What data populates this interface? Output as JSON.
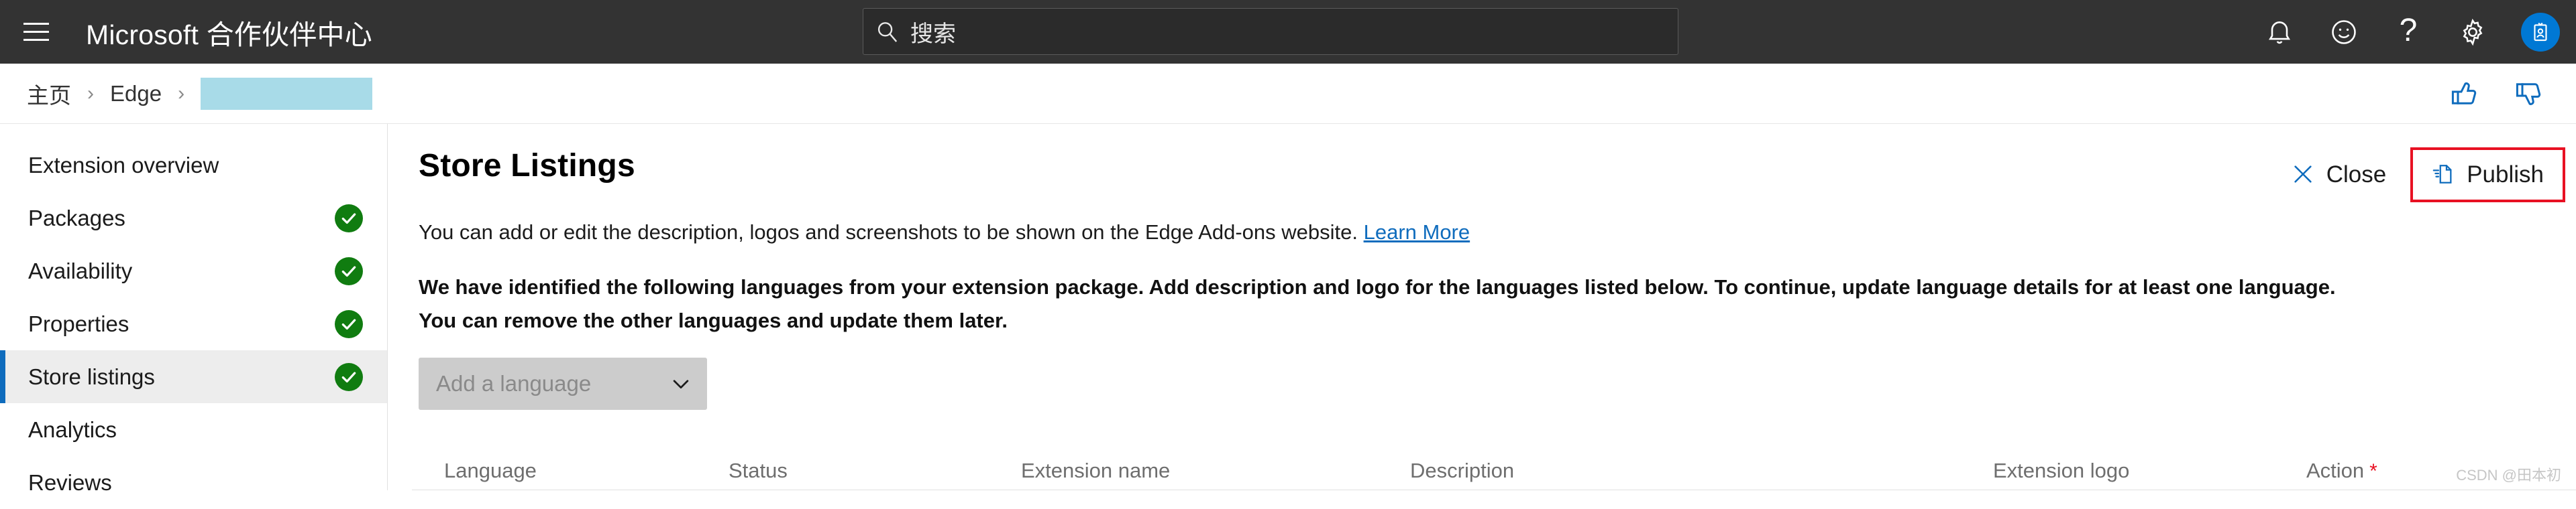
{
  "header": {
    "menu_icon": "hamburger-icon",
    "brand": "Microsoft 合作伙伴中心",
    "search": {
      "icon": "search-icon",
      "placeholder": "搜索",
      "value": ""
    },
    "icons": [
      {
        "name": "bell-icon",
        "label": "Notifications"
      },
      {
        "name": "smiley-icon",
        "label": "Feedback"
      },
      {
        "name": "question-icon",
        "label": "Help"
      },
      {
        "name": "gear-icon",
        "label": "Settings"
      }
    ],
    "avatar": {
      "name": "account-badge-icon",
      "color": "#0078d4"
    },
    "background": "#333333"
  },
  "breadcrumb": {
    "items": [
      "主页",
      "Edge"
    ],
    "separator": "›",
    "redacted_item": "",
    "feedback": [
      {
        "name": "thumbs-up-icon",
        "color": "#0f6cbd"
      },
      {
        "name": "thumbs-down-icon",
        "color": "#0f6cbd"
      }
    ]
  },
  "sidebar": {
    "items": [
      {
        "label": "Extension overview",
        "complete": false,
        "active": false
      },
      {
        "label": "Packages",
        "complete": true,
        "active": false
      },
      {
        "label": "Availability",
        "complete": true,
        "active": false
      },
      {
        "label": "Properties",
        "complete": true,
        "active": false
      },
      {
        "label": "Store listings",
        "complete": true,
        "active": true
      },
      {
        "label": "Analytics",
        "complete": false,
        "active": false
      },
      {
        "label": "Reviews",
        "complete": false,
        "active": false
      }
    ],
    "check_color": "#107c10",
    "active_bar_color": "#0f6cbd"
  },
  "main": {
    "title": "Store Listings",
    "close_label": "Close",
    "publish_label": "Publish",
    "publish_highlight_color": "#e81123",
    "intro_text": "You can add or edit the description, logos and screenshots to be shown on the Edge Add-ons website.",
    "intro_link": "Learn More",
    "notice_text": "We have identified the following languages from your extension package. Add description and logo for the languages listed below. To continue, update language details for at least one language. You can remove the other languages and update them later.",
    "language_dropdown": {
      "placeholder": "Add a language",
      "value": "",
      "chevron": "chevron-down-icon"
    },
    "table": {
      "columns": [
        {
          "label": "Language",
          "required": false
        },
        {
          "label": "Status",
          "required": false
        },
        {
          "label": "Extension name",
          "required": false
        },
        {
          "label": "Description",
          "required": false
        },
        {
          "label": "Extension logo",
          "required": false
        },
        {
          "label": "Action",
          "required": true
        }
      ],
      "required_marker": "*",
      "rows": []
    }
  },
  "watermark": "CSDN @田本初"
}
